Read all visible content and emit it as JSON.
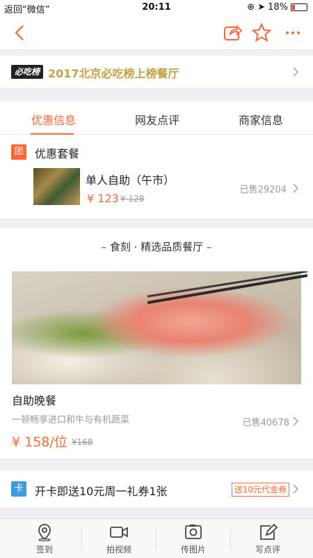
{
  "status_bar": {
    "back_label": "返回“微信”",
    "time": "20:11",
    "battery": "18%",
    "battery_level": 0.18
  },
  "navbar": {
    "icons": [
      "back-arrow-icon",
      "share-icon",
      "star-icon",
      "more-icon"
    ],
    "accent_color": "#ff6633"
  },
  "ranking": {
    "logo_text": "必吃榜",
    "text": "2017北京必吃榜上榜餐厅",
    "text_color": "#c7a042"
  },
  "tabs": [
    {
      "label": "优惠信息",
      "active": true
    },
    {
      "label": "网友点评",
      "active": false
    },
    {
      "label": "商家信息",
      "active": false
    }
  ],
  "deals": {
    "icon_text": "团",
    "title": "优惠套餐",
    "item": {
      "name": "单人自助（午市）",
      "price": "¥ 123",
      "original_price": "¥ 128",
      "sold": "已售29204"
    }
  },
  "featured": {
    "header": "– 食刻 · 精选品质餐厅 –",
    "name": "自助晚餐",
    "description": "一顿畅享进口和牛与有机蔬菜",
    "sold": "已售40678",
    "price": "¥ 158/位",
    "original_price": "¥168"
  },
  "card": {
    "icon_text": "卡",
    "text": "开卡即送10元周一礼券1张",
    "badge": "送10元代金券"
  },
  "tabbar": {
    "items": [
      {
        "label": "签到",
        "icon": "location-pin-icon"
      },
      {
        "label": "拍视频",
        "icon": "video-camera-icon"
      },
      {
        "label": "传图片",
        "icon": "photo-icon"
      },
      {
        "label": "写点评",
        "icon": "edit-icon"
      }
    ]
  }
}
